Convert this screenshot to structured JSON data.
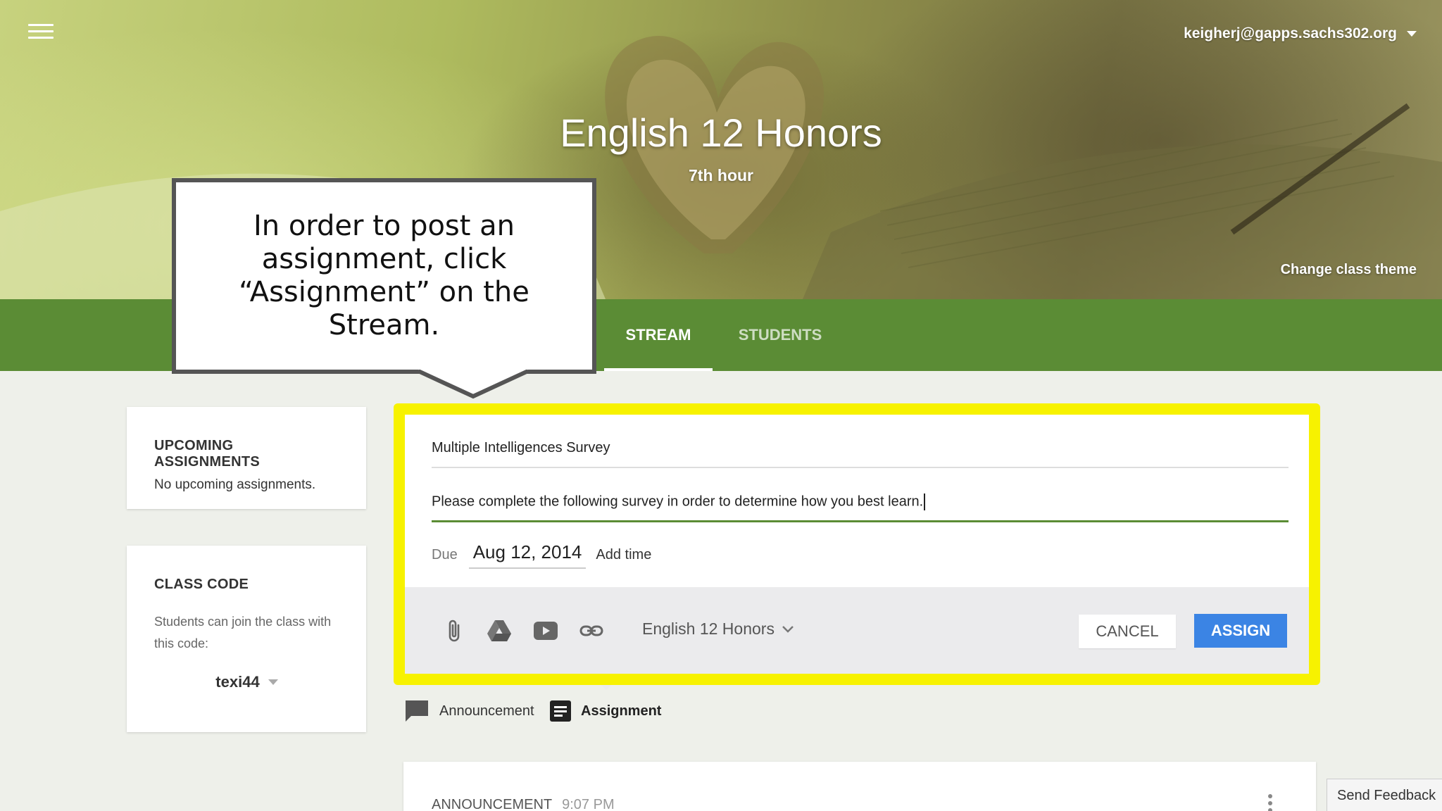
{
  "header": {
    "account_email": "keigherj@gapps.sachs302.org",
    "class_name": "English 12 Honors",
    "class_section": "7th hour",
    "change_theme_label": "Change class theme"
  },
  "tabs": [
    {
      "label": "STREAM",
      "active": true
    },
    {
      "label": "STUDENTS",
      "active": false
    }
  ],
  "callout": {
    "text": "In order to post an assignment, click “Assignment” on the Stream."
  },
  "sidebar": {
    "upcoming": {
      "heading": "UPCOMING ASSIGNMENTS",
      "text": "No upcoming assignments."
    },
    "class_code": {
      "heading": "CLASS CODE",
      "text": "Students can join the class with this code:",
      "code": "texi44"
    }
  },
  "assignment_form": {
    "title_value": "Multiple Intelligences Survey",
    "description_value": "Please complete the following survey in order to determine how you best learn.",
    "due_label": "Due",
    "due_date": "Aug 12, 2014",
    "add_time_label": "Add time",
    "class_select_value": "English 12 Honors",
    "cancel_label": "CANCEL",
    "assign_label": "ASSIGN"
  },
  "post_types": [
    {
      "label": "Announcement",
      "icon": "comment-icon"
    },
    {
      "label": "Assignment",
      "icon": "assignment-icon"
    }
  ],
  "stream": {
    "post_type": "ANNOUNCEMENT",
    "post_time": "9:07 PM"
  },
  "feedback_label": "Send Feedback",
  "colors": {
    "tabbar": "#5b8c35",
    "highlight": "#f7f200",
    "assign_button": "#3b84e4"
  }
}
